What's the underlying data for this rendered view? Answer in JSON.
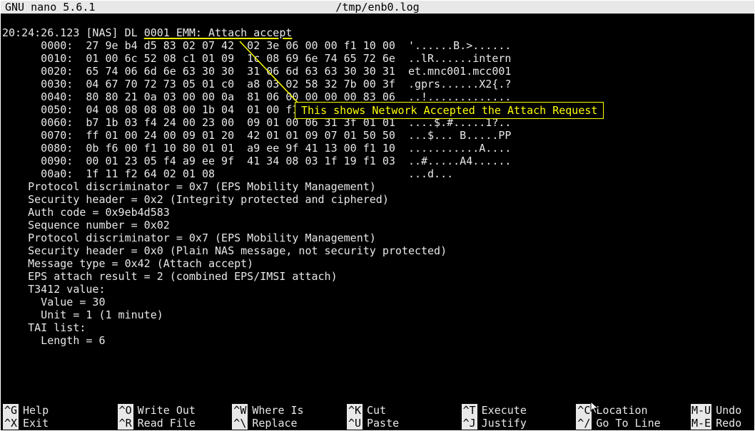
{
  "title": {
    "app": "GNU nano 5.6.1",
    "file": "/tmp/enb0.log"
  },
  "annotation": "This shows Network Accepted the Attach Request",
  "log": {
    "ts": "20:24:26.123 [NAS] DL ",
    "uid": "0001 EMM: Attach accept",
    "hex": [
      "      0000:  27 9e b4 d5 83 02 07 42  02 3e 06 00 00 f1 10 00  '......B.>......",
      "      0010:  01 00 6c 52 08 c1 01 09  1c 08 69 6e 74 65 72 6e  ..lR......intern",
      "      0020:  65 74 06 6d 6e 63 30 30  31 06 6d 63 63 30 30 31  et.mnc001.mcc001",
      "      0030:  04 67 70 72 73 05 01 c0  a8 03 02 58 32 7b 00 3f  .gprs......X2{.?",
      "      0040:  80 80 21 0a 03 00 00 0a  81 06 00 00 00 00 83 06  ..!.............",
      "      0050:  04 08 08 08 08 00 1b 04  01 00 f1 10 00 1d 06 04  ................",
      "      0060:  b7 1b 03 f4 24 00 23 00  09 01 00 06 31 3f 01 01  ....$.#.....1?..",
      "      0070:  ff 01 00 24 00 09 01 20  42 01 01 09 07 01 50 50  ...$... B.....PP",
      "      0080:  0b f6 00 f1 10 80 01 01  a9 ee 9f 41 13 00 f1 10  ...........A....",
      "      0090:  00 01 23 05 f4 a9 ee 9f  41 34 08 03 1f 19 f1 03  ..#.....A4......",
      "      00a0:  1f 11 f2 64 02 01 08                              ...d..."
    ],
    "fields": [
      "    Protocol discriminator = 0x7 (EPS Mobility Management)",
      "    Security header = 0x2 (Integrity protected and ciphered)",
      "    Auth code = 0x9eb4d583",
      "    Sequence number = 0x02",
      "    Protocol discriminator = 0x7 (EPS Mobility Management)",
      "    Security header = 0x0 (Plain NAS message, not security protected)",
      "    Message type = 0x42 (Attach accept)",
      "    EPS attach result = 2 (combined EPS/IMSI attach)",
      "    T3412 value:",
      "      Value = 30",
      "      Unit = 1 (1 minute)",
      "    TAI list:",
      "      Length = 6"
    ]
  },
  "shortcuts": [
    {
      "k": "^G",
      "l": "Help"
    },
    {
      "k": "^O",
      "l": "Write Out"
    },
    {
      "k": "^W",
      "l": "Where Is"
    },
    {
      "k": "^K",
      "l": "Cut"
    },
    {
      "k": "^T",
      "l": "Execute"
    },
    {
      "k": "^C",
      "l": "Location"
    },
    {
      "k": "M-U",
      "l": "Undo"
    },
    {
      "k": "^X",
      "l": "Exit"
    },
    {
      "k": "^R",
      "l": "Read File"
    },
    {
      "k": "^\\",
      "l": "Replace"
    },
    {
      "k": "^U",
      "l": "Paste"
    },
    {
      "k": "^J",
      "l": "Justify"
    },
    {
      "k": "^/",
      "l": "Go To Line"
    },
    {
      "k": "M-E",
      "l": "Redo"
    }
  ]
}
